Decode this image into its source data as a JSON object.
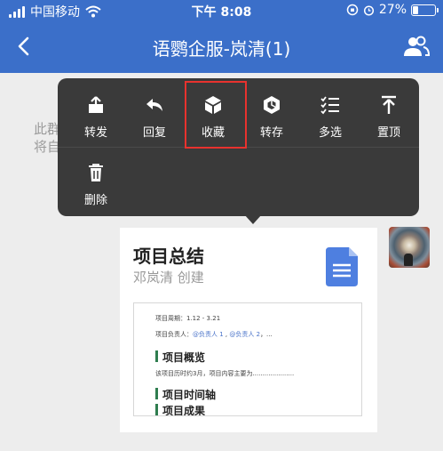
{
  "status_bar": {
    "carrier": "中国移动",
    "time": "下午 8:08",
    "battery": "27%",
    "battery_level": 0.27
  },
  "nav": {
    "title": "语鹦企服-岚清(1)"
  },
  "hint": {
    "line1": "此群",
    "line2": "将自"
  },
  "menu": {
    "items": [
      {
        "label": "转发",
        "icon": "share-icon"
      },
      {
        "label": "回复",
        "icon": "reply-icon"
      },
      {
        "label": "收藏",
        "icon": "favorite-box-icon"
      },
      {
        "label": "转存",
        "icon": "save-to-icon"
      },
      {
        "label": "多选",
        "icon": "multi-select-icon"
      },
      {
        "label": "置顶",
        "icon": "pin-top-icon"
      },
      {
        "label": "删除",
        "icon": "trash-icon"
      }
    ],
    "highlight_color": "#e8322e"
  },
  "message": {
    "title": "项目总结",
    "subtitle": "邓岚清 创建",
    "preview": {
      "period": "项目周期：1.12 - 3.21",
      "owner_label": "项目负责人：",
      "owner1": "@负责人 1",
      "owner2": "@负责人 2",
      "owner_tail": "，...",
      "sec1": "项目概览",
      "sec1_text": "该项目历时约3月，项目内容主要为.....................",
      "sec2": "项目时间轴",
      "sec3": "项目成果"
    }
  },
  "colors": {
    "header": "#3b6fc9",
    "menu_bg": "#3a3a3a",
    "doc_icon": "#4e7fe0"
  }
}
